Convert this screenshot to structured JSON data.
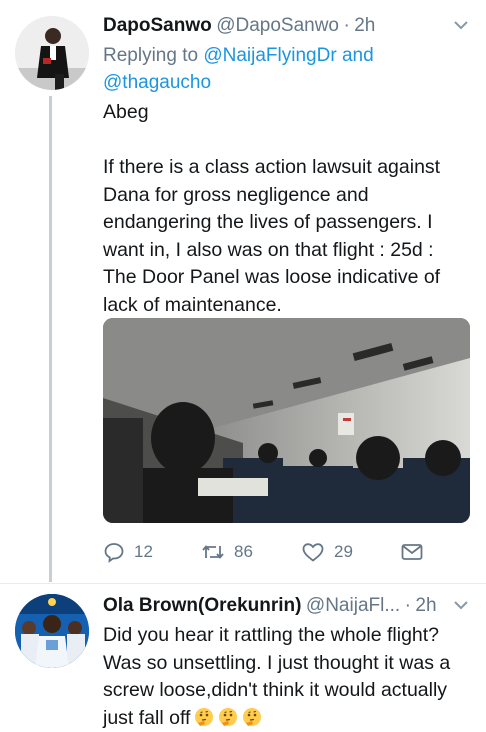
{
  "tweets": [
    {
      "name": "DapoSanwo",
      "handle": "@DapoSanwo",
      "dot": "·",
      "time": "2h",
      "replying_prefix": "Replying to ",
      "replying_to": [
        "@NaijaFlyingDr",
        "@thagaucho"
      ],
      "replying_joiner": " and",
      "text": "Abeg\n\nIf there is a class action lawsuit against Dana for gross negligence and endangering the lives of passengers. I want in, I also was on that flight : 25d : The Door Panel was loose indicative of lack of maintenance.",
      "has_media": true,
      "replies": "12",
      "retweets": "86",
      "likes": "29"
    },
    {
      "name": "Ola Brown(Orekunrin)",
      "handle": "@NaijaFl...",
      "dot": "·",
      "time": "2h",
      "text": "Did you hear it rattling the whole flight? Was so unsettling. I just thought it was a screw loose,didn't think it would actually just fall off",
      "trailing_emoji": [
        "thinking-face-icon",
        "thinking-face-icon",
        "thinking-face-icon"
      ]
    }
  ],
  "colors": {
    "text": "#14171a",
    "secondary": "#657786",
    "link": "#1b95e0",
    "thread_line": "#c4cfd6"
  }
}
